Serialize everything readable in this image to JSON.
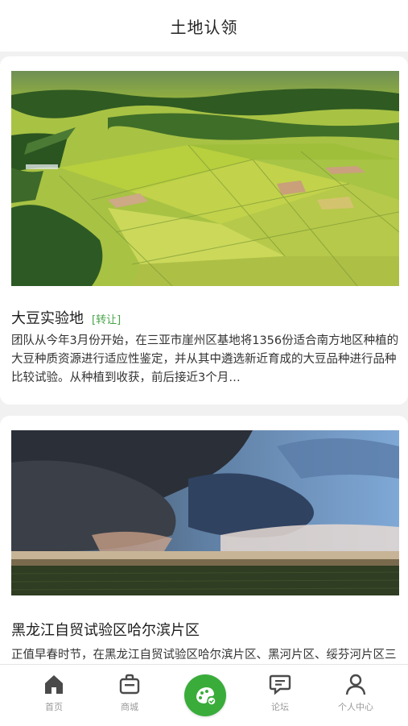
{
  "header": {
    "title": "土地认领"
  },
  "cards": [
    {
      "name": "大豆实验地",
      "tag": "[转让]",
      "description": "团队从今年3月份开始，在三亚市崖州区基地将1356份适合南方地区种植的大豆种质资源进行适应性鉴定，并从其中遴选新近育成的大豆品种进行品种比较试验。从种植到收获，前后接近3个月…",
      "image": "aerial-green-farmland"
    },
    {
      "name": "黑龙江自贸试验区哈尔滨片区",
      "description": "正值早春时节，在黑龙江自贸试验区哈尔滨片区、黑河片区、绥芬河片区三个片区内，项目建设、招商引资等重点工作已全面铺开",
      "image": "storm-clouds-over-farmland"
    }
  ],
  "tabbar": {
    "items": [
      {
        "label": "首页",
        "icon": "home-icon"
      },
      {
        "label": "商城",
        "icon": "bag-icon"
      },
      {
        "label": "",
        "icon": "land-claim-icon"
      },
      {
        "label": "论坛",
        "icon": "forum-icon"
      },
      {
        "label": "个人中心",
        "icon": "person-icon"
      }
    ]
  },
  "colors": {
    "accent": "#3aac3a",
    "tag": "#47a347",
    "tab_inactive": "#9a9a9a"
  }
}
